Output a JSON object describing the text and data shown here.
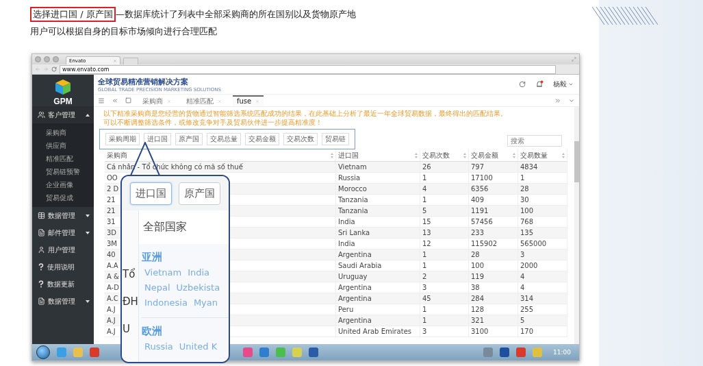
{
  "heading": {
    "highlight": "选择进口国 / 原产国",
    "rest": "—数据库统计了列表中全部采购商的所在国别以及货物原产地",
    "line2": "用户可以根据自身的目标市场倾向进行合理匹配"
  },
  "browser": {
    "tab": "Envato",
    "url": "www.envato.com"
  },
  "app": {
    "logo_text": "GPM",
    "title": "全球贸易精准营销解决方案",
    "subtitle": "GLOBAL TRADE PRECISION MARKETING SOLUTIONS",
    "user": "杨毅",
    "sidebar": [
      {
        "label": "客户管理",
        "kind": "users",
        "expanded": true,
        "children": [
          {
            "label": "采购商"
          },
          {
            "label": "供应商"
          },
          {
            "label": "精准匹配"
          },
          {
            "label": "贸易链预警"
          },
          {
            "label": "企业画像"
          },
          {
            "label": "贸易促成"
          }
        ]
      },
      {
        "label": "数据管理",
        "kind": "table",
        "expanded": false
      },
      {
        "label": "邮件管理",
        "kind": "doc",
        "expanded": false
      },
      {
        "label": "用户管理",
        "kind": "user"
      },
      {
        "label": "使用说明",
        "kind": "help"
      },
      {
        "label": "数据更新",
        "kind": "help"
      },
      {
        "label": "数据管理",
        "kind": "doc",
        "expanded": false
      }
    ],
    "tabs": [
      {
        "label": "采购商",
        "selected": false
      },
      {
        "label": "精准匹配",
        "selected": false
      },
      {
        "label": "fuse",
        "selected": true
      }
    ],
    "notice": [
      "以下精准采购商是您经营的货物通过智能筛选系统匹配成功的结果，在此基础上分析了最近一年全球贸易数据，最终得出的匹配结果。",
      "可以不断调整筛选条件，或修改竞争对手及贸易伙伴进一步提高精准度！"
    ],
    "filters": [
      "采购周期",
      "进口国",
      "原产国",
      "交易总量",
      "交易金额",
      "交易次数",
      "贸易链"
    ],
    "search": {
      "placeholder": "搜索"
    },
    "table": {
      "columns": [
        "采购商",
        "进口国",
        "交易次数",
        "交易金额",
        "交易数量"
      ],
      "rows": [
        [
          "Cá nhân - Tổ chức không có mã số thuế",
          "Vietnam",
          "26",
          "797",
          "4834"
        ],
        [
          "OO",
          "Russia",
          "1",
          "17100",
          "1"
        ],
        [
          "2 D",
          "Morocco",
          "4",
          "6356",
          "28"
        ],
        [
          "21",
          "Tanzania",
          "1",
          "409",
          "30"
        ],
        [
          "21",
          "Tanzania",
          "5",
          "1191",
          "100"
        ],
        [
          "31",
          "India",
          "15",
          "57456",
          "768"
        ],
        [
          "3D",
          "Sri Lanka",
          "13",
          "233",
          "135"
        ],
        [
          "3M",
          "India",
          "12",
          "115902",
          "565000"
        ],
        [
          "40",
          "Argentina",
          "1",
          "28",
          "3"
        ],
        [
          "A.A",
          "Saudi Arabia",
          "1",
          "100",
          "2000"
        ],
        [
          "A &",
          "Uruguay",
          "2",
          "119",
          "4"
        ],
        [
          "A-D",
          "Argentina",
          "3",
          "38",
          "4"
        ],
        [
          "A.C",
          "Argentina",
          "45",
          "284",
          "314"
        ],
        [
          "A.J",
          "Peru",
          "1",
          "128",
          "255"
        ],
        [
          "A.J",
          "Argentina",
          "1",
          "321",
          "5"
        ],
        [
          "A.J",
          "United Arab Emirates",
          "3",
          "3100",
          "170"
        ]
      ]
    }
  },
  "callout": {
    "buttons": [
      {
        "label": "进口国",
        "selected": true
      },
      {
        "label": "原产国",
        "selected": false
      }
    ],
    "all_label": "全部国家",
    "strip_letters": [
      "Tổ",
      "ĐH",
      "U"
    ],
    "regions": [
      {
        "name": "亚洲",
        "rows": [
          [
            "Vietnam",
            "India"
          ],
          [
            "Nepal",
            "Uzbekista"
          ],
          [
            "Indonesia",
            "Myan"
          ]
        ]
      },
      {
        "name": "欧洲",
        "rows": [
          [
            "Russia",
            "United K"
          ]
        ]
      }
    ]
  },
  "taskbar": {
    "time": "11:00"
  }
}
